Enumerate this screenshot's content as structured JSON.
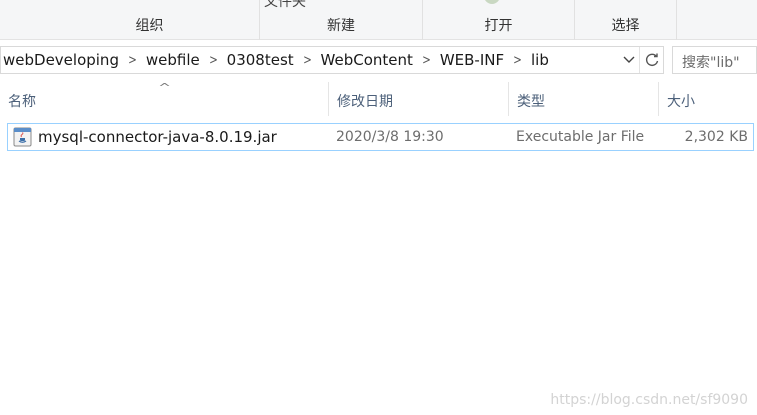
{
  "ribbon": {
    "top_partial_text": "文件夹",
    "groups": [
      {
        "label": "组织"
      },
      {
        "label": "新建"
      },
      {
        "label": "打开"
      },
      {
        "label": "选择"
      }
    ]
  },
  "address": {
    "crumbs": [
      "webDeveloping",
      "webfile",
      "0308test",
      "WebContent",
      "WEB-INF",
      "lib"
    ]
  },
  "search": {
    "placeholder": "搜索\"lib\""
  },
  "columns": {
    "name": "名称",
    "date": "修改日期",
    "type": "类型",
    "size": "大小"
  },
  "files": [
    {
      "name": "mysql-connector-java-8.0.19.jar",
      "date": "2020/3/8 19:30",
      "type": "Executable Jar File",
      "size": "2,302 KB",
      "icon": "java-jar-icon"
    }
  ],
  "watermark": "https://blog.csdn.net/sf9090",
  "colors": {
    "selection_border": "#99d1ff",
    "header_text": "#4c607a"
  }
}
